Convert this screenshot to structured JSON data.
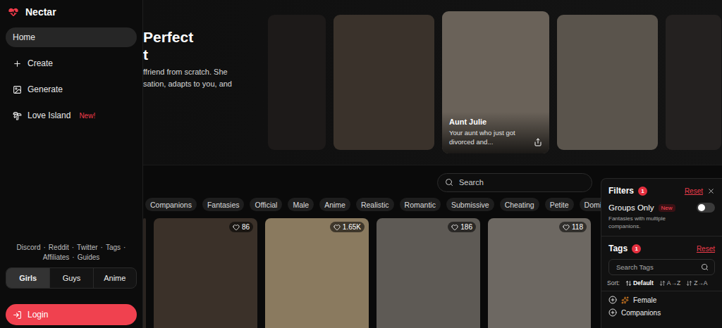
{
  "logo": {
    "title": "Nectar"
  },
  "nav": [
    {
      "label": "Home",
      "selected": true,
      "badge": ""
    },
    {
      "label": "Create",
      "selected": false,
      "badge": ""
    },
    {
      "label": "Generate",
      "selected": false,
      "badge": ""
    },
    {
      "label": "Love Island",
      "selected": false,
      "badge": "New!"
    }
  ],
  "footer_links": [
    [
      "Discord",
      "Reddit",
      "Twitter",
      "Tags"
    ],
    [
      "Affiliates",
      "Guides"
    ]
  ],
  "footer_separator": "·",
  "segments": [
    {
      "label": "Girls",
      "selected": true
    },
    {
      "label": "Guys",
      "selected": false
    },
    {
      "label": "Anime",
      "selected": false
    }
  ],
  "login": "Login",
  "hero": {
    "title_lines": [
      "Perfect",
      "t"
    ],
    "text_lines": [
      "ffriend from scratch. She",
      "sation, adapts to you, and"
    ],
    "cards": [
      {
        "title": "",
        "description": ""
      },
      {
        "title": "",
        "description": ""
      },
      {
        "title": "Aunt Julie",
        "description": "Your aunt who just got divorced and..."
      },
      {
        "title": "",
        "description": ""
      },
      {
        "title": "",
        "description": ""
      }
    ]
  },
  "search": {
    "placeholder": "Search"
  },
  "chips": [
    "Companions",
    "Fantasies",
    "Official",
    "Male",
    "Anime",
    "Realistic",
    "Romantic",
    "Submissive",
    "Cheating",
    "Petite",
    "Dominant"
  ],
  "cards": [
    {
      "likes": ""
    },
    {
      "likes": "86"
    },
    {
      "likes": "1.65K"
    },
    {
      "likes": "186"
    },
    {
      "likes": "118"
    }
  ],
  "filters": {
    "title": "Filters",
    "count": "1",
    "reset": "Reset",
    "groups": {
      "label": "Groups Only",
      "badge": "New",
      "description": "Fantasies with multiple companions.",
      "on": false
    },
    "tags": {
      "title": "Tags",
      "count": "1",
      "reset": "Reset",
      "placeholder": "Search Tags"
    },
    "sort": {
      "label": "Sort:",
      "options": [
        {
          "label": "Default",
          "selected": true
        },
        {
          "label": "A→Z",
          "selected": false
        },
        {
          "label": "Z→A",
          "selected": false
        }
      ]
    },
    "tag_list": [
      "Female",
      "Companions"
    ]
  }
}
